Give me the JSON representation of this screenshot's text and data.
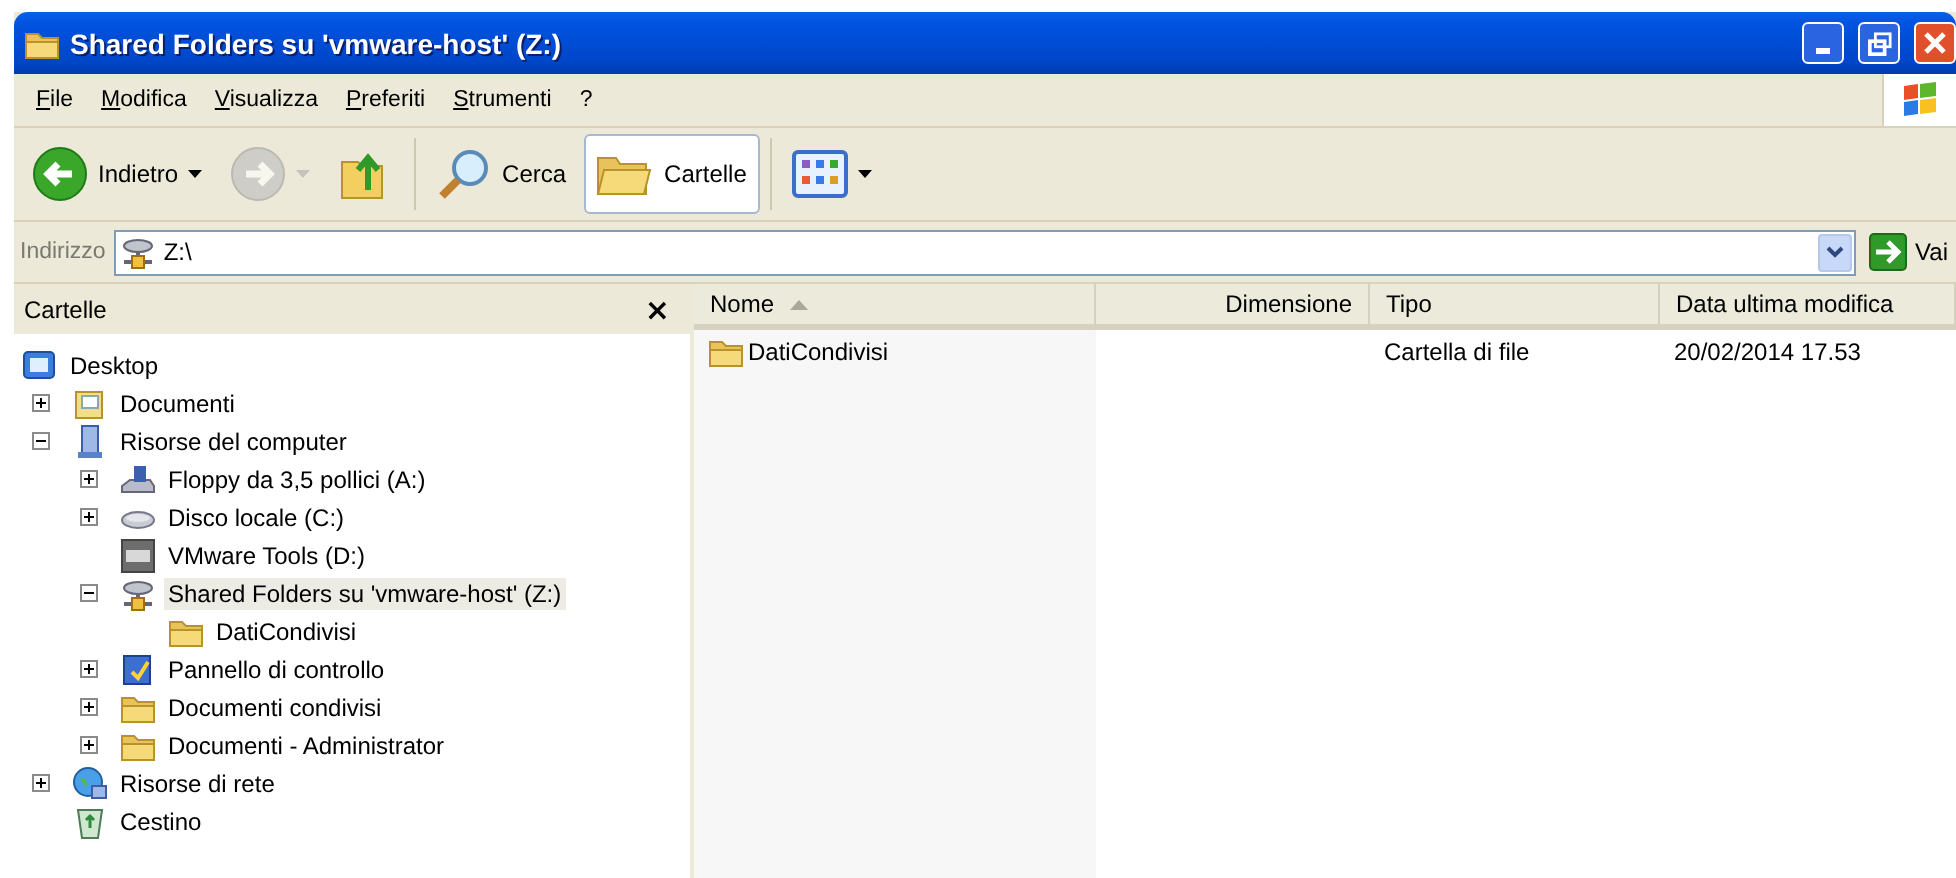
{
  "window": {
    "title": "Shared Folders su 'vmware-host' (Z:)"
  },
  "menu": [
    "File",
    "Modifica",
    "Visualizza",
    "Preferiti",
    "Strumenti",
    "?"
  ],
  "toolbar": [
    {
      "kind": "back",
      "label": "Indietro",
      "disabled": false,
      "pressed": false
    },
    {
      "kind": "forward",
      "disabled": true,
      "pressed": false
    },
    {
      "kind": "up",
      "disabled": false,
      "pressed": false
    },
    {
      "kind": "search",
      "label": "Cerca",
      "disabled": false,
      "pressed": false
    },
    {
      "kind": "folders",
      "label": "Cartelle",
      "disabled": false,
      "pressed": true
    },
    {
      "kind": "views",
      "disabled": false,
      "pressed": false
    }
  ],
  "address": {
    "label": "Indirizzo",
    "value": "Z:\\",
    "go": "Vai"
  },
  "folders_pane": {
    "title": "Cartelle",
    "close": "×",
    "tree": [
      {
        "label": "Desktop",
        "kind": "desktop",
        "selected": false,
        "children": [
          {
            "label": "Documenti",
            "kind": "documents",
            "expanded": false,
            "selected": false
          },
          {
            "label": "Risorse del computer",
            "kind": "computer",
            "expanded": true,
            "selected": false,
            "children": [
              {
                "label": "Floppy da 3,5 pollici (A:)",
                "kind": "floppy",
                "expanded": false,
                "selected": false
              },
              {
                "label": "Disco locale (C:)",
                "kind": "disk",
                "expanded": false,
                "selected": false
              },
              {
                "label": "VMware Tools (D:)",
                "kind": "vmware",
                "selected": false
              },
              {
                "label": "Shared Folders su 'vmware-host' (Z:)",
                "kind": "share",
                "expanded": true,
                "selected": true,
                "children": [
                  {
                    "label": "DatiCondivisi",
                    "kind": "folder",
                    "selected": false
                  }
                ]
              },
              {
                "label": "Pannello di controllo",
                "kind": "control",
                "expanded": false,
                "selected": false
              },
              {
                "label": "Documenti condivisi",
                "kind": "folder",
                "expanded": false,
                "selected": false
              },
              {
                "label": "Documenti - Administrator",
                "kind": "folder",
                "expanded": false,
                "selected": false
              }
            ]
          },
          {
            "label": "Risorse di rete",
            "kind": "network",
            "expanded": false,
            "selected": false
          },
          {
            "label": "Cestino",
            "kind": "recycle",
            "selected": false
          }
        ]
      }
    ]
  },
  "file_list": {
    "columns": [
      {
        "label": "Nome",
        "kind": "name",
        "sorted": true
      },
      {
        "label": "Dimensione",
        "kind": "size",
        "sorted": false
      },
      {
        "label": "Tipo",
        "kind": "type",
        "sorted": false
      },
      {
        "label": "Data ultima modifica",
        "kind": "date",
        "sorted": false
      }
    ],
    "rows": [
      {
        "name": "DatiCondivisi",
        "type": "Cartella di file",
        "modified": "20/02/2014 17.53",
        "selected": false
      }
    ]
  }
}
